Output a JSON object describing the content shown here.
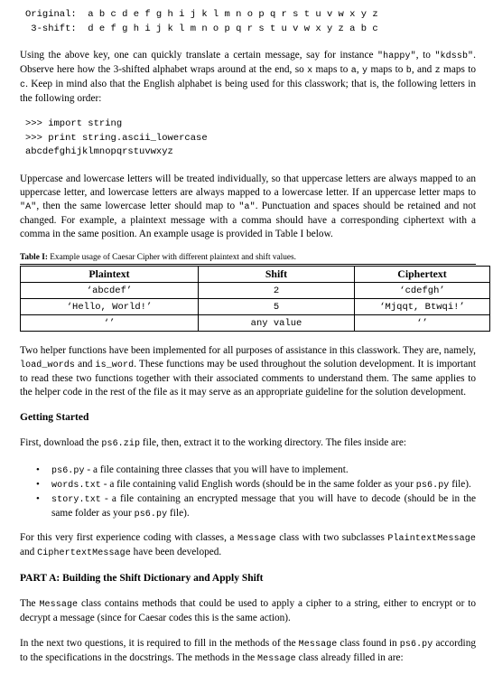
{
  "document": {
    "key_block": {
      "line1": "Original:  a b c d e f g h i j k l m n o p q r s t u v w x y z",
      "line2": " 3-shift:  d e f g h i j k l m n o p q r s t u v w x y z a b c"
    },
    "intro_paragraph": {
      "seg1": "Using the above key, one can quickly translate a certain message, say for instance ",
      "code1": "\"happy\"",
      "seg2": ", to ",
      "code2": "\"kdssb\"",
      "seg3": ". Observe here how the 3-shifted alphabet wraps around at the end, so ",
      "code3": "x",
      "seg4": " maps to ",
      "code4": "a",
      "seg5": ", ",
      "code5": "y",
      "seg6": " maps to ",
      "code6": "b",
      "seg7": ", and ",
      "code7": "z",
      "seg8": " maps to ",
      "code8": "c",
      "seg9": ". Keep in mind also that the English alphabet is being used for this classwork; that is, the following letters in the following order:"
    },
    "code_block": {
      "line1": ">>> import string",
      "line2": ">>> print string.ascii_lowercase",
      "line3": "abcdefghijklmnopqrstuvwxyz"
    },
    "case_paragraph": {
      "seg1": "Uppercase and lowercase letters will be treated individually, so that uppercase letters are always mapped to an uppercase letter, and lowercase letters are always mapped to a lowercase letter. If an uppercase letter maps to ",
      "code1": "\"A\"",
      "seg2": ", then the same lowercase letter should map to ",
      "code2": "\"a\"",
      "seg3": ". Punctuation and spaces should be retained and not changed. For example, a plaintext message with a comma should have a corresponding ciphertext with a comma in the same position. An example usage is provided in Table I below."
    },
    "table": {
      "caption_label": "Table I:",
      "caption_text": " Example usage of Caesar Cipher with different plaintext and shift values.",
      "headers": [
        "Plaintext",
        "Shift",
        "Ciphertext"
      ],
      "rows": [
        [
          "‘abcdef’",
          "2",
          "‘cdefgh’"
        ],
        [
          "‘Hello, World!’",
          "5",
          "‘Mjqqt, Btwqi!’"
        ],
        [
          "‘’",
          "any value",
          "‘’"
        ]
      ]
    },
    "helper_paragraph": {
      "seg1": "Two helper functions have been implemented for all purposes of assistance in this classwork. They are, namely, ",
      "code1": "load_words",
      "seg2": " and ",
      "code2": "is_word",
      "seg3": ". These functions may be used throughout the solution development. It is important to read these two functions together with their associated comments to understand them. The same applies to the helper code in the rest of the file as it may serve as an appropriate guideline for the solution development."
    },
    "getting_started_heading": "Getting Started",
    "download_paragraph": {
      "seg1": "First, download the ",
      "code1": "ps6.zip",
      "seg2": " file, then, extract it to the working directory. The files inside are:"
    },
    "file_list": [
      {
        "bullet": "•",
        "code1": "ps6.py",
        "seg1": " - a file containing three classes that you will have to implement.",
        "code2": "",
        "seg2": ""
      },
      {
        "bullet": "•",
        "code1": "words.txt",
        "seg1": " - a file containing valid English words (should be in the same folder as your ",
        "code2": "ps6.py",
        "seg2": " file)."
      },
      {
        "bullet": "•",
        "code1": "story.txt",
        "seg1": " - a file containing an encrypted message that you will have to decode (should be in the same folder as your ",
        "code2": "ps6.py",
        "seg2": " file)."
      }
    ],
    "classes_paragraph": {
      "seg1": "For this very first experience coding with classes, a ",
      "code1": "Message",
      "seg2": " class with two subclasses ",
      "code2": "PlaintextMessage",
      "seg3": " and ",
      "code3": "CiphertextMessage",
      "seg4": " have been developed."
    },
    "part_a_heading": "PART A: Building the Shift Dictionary and Apply Shift",
    "message_paragraph": {
      "seg1": "The ",
      "code1": "Message",
      "seg2": " class contains methods that could be used to apply a cipher to a string, either to encrypt or to decrypt a message (since for Caesar codes this is the same action)."
    },
    "next_paragraph": {
      "seg1": "In the next two questions, it is required to fill in the methods of the ",
      "code1": "Message",
      "seg2": " class found in ",
      "code2": "ps6.py",
      "seg3": " according to the specifications in the docstrings. The methods in the ",
      "code3": "Message",
      "seg4": " class already filled in are:"
    }
  }
}
